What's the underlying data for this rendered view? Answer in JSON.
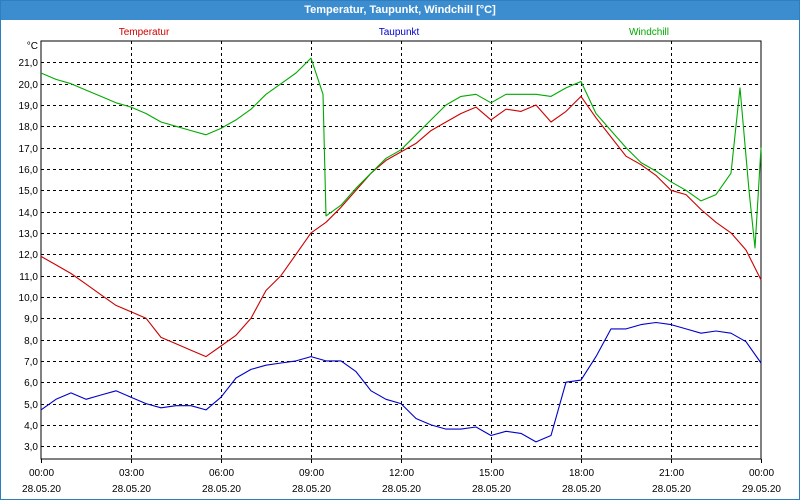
{
  "window": {
    "title": "Temperatur, Taupunkt, Windchill [°C]"
  },
  "chart_data": {
    "type": "line",
    "title": "Temperatur, Taupunkt, Windchill [°C]",
    "ylabel": "°C",
    "ylim": [
      2.4,
      22.0
    ],
    "yticks": [
      "21,0",
      "20,0",
      "19,0",
      "18,0",
      "17,0",
      "16,0",
      "15,0",
      "14,0",
      "13,0",
      "12,0",
      "11,0",
      "10,0",
      "9,0",
      "8,0",
      "7,0",
      "6,0",
      "5,0",
      "4,0",
      "3,0"
    ],
    "xlim": [
      0,
      24
    ],
    "xticks": [
      {
        "time": "00:00",
        "date": "28.05.20"
      },
      {
        "time": "03:00",
        "date": "28.05.20"
      },
      {
        "time": "06:00",
        "date": "28.05.20"
      },
      {
        "time": "09:00",
        "date": "28.05.20"
      },
      {
        "time": "12:00",
        "date": "28.05.20"
      },
      {
        "time": "15:00",
        "date": "28.05.20"
      },
      {
        "time": "18:00",
        "date": "28.05.20"
      },
      {
        "time": "21:00",
        "date": "28.05.20"
      },
      {
        "time": "00:00",
        "date": "29.05.20"
      }
    ],
    "grid": true,
    "legend_position": "top",
    "series": [
      {
        "name": "Temperatur",
        "color": "#cc0000",
        "points": [
          [
            0.0,
            11.9
          ],
          [
            0.5,
            11.5
          ],
          [
            1.0,
            11.1
          ],
          [
            1.5,
            10.6
          ],
          [
            2.0,
            10.1
          ],
          [
            2.5,
            9.6
          ],
          [
            3.0,
            9.3
          ],
          [
            3.5,
            9.0
          ],
          [
            4.0,
            8.1
          ],
          [
            4.5,
            7.8
          ],
          [
            5.0,
            7.5
          ],
          [
            5.5,
            7.2
          ],
          [
            6.0,
            7.7
          ],
          [
            6.5,
            8.2
          ],
          [
            7.0,
            9.0
          ],
          [
            7.5,
            10.3
          ],
          [
            8.0,
            11.0
          ],
          [
            8.5,
            12.0
          ],
          [
            9.0,
            13.0
          ],
          [
            9.5,
            13.5
          ],
          [
            10.0,
            14.2
          ],
          [
            10.5,
            15.0
          ],
          [
            11.0,
            15.8
          ],
          [
            11.5,
            16.4
          ],
          [
            12.0,
            16.8
          ],
          [
            12.5,
            17.2
          ],
          [
            13.0,
            17.8
          ],
          [
            13.5,
            18.2
          ],
          [
            14.0,
            18.6
          ],
          [
            14.5,
            18.9
          ],
          [
            15.0,
            18.3
          ],
          [
            15.5,
            18.8
          ],
          [
            16.0,
            18.7
          ],
          [
            16.5,
            19.0
          ],
          [
            17.0,
            18.2
          ],
          [
            17.5,
            18.7
          ],
          [
            18.0,
            19.4
          ],
          [
            18.5,
            18.4
          ],
          [
            19.0,
            17.5
          ],
          [
            19.5,
            16.6
          ],
          [
            20.0,
            16.2
          ],
          [
            20.5,
            15.7
          ],
          [
            21.0,
            15.0
          ],
          [
            21.5,
            14.8
          ],
          [
            22.0,
            14.1
          ],
          [
            22.5,
            13.5
          ],
          [
            23.0,
            13.0
          ],
          [
            23.5,
            12.2
          ],
          [
            24.0,
            10.8
          ]
        ]
      },
      {
        "name": "Taupunkt",
        "color": "#0000cc",
        "points": [
          [
            0.0,
            4.7
          ],
          [
            0.5,
            5.2
          ],
          [
            1.0,
            5.5
          ],
          [
            1.5,
            5.2
          ],
          [
            2.0,
            5.4
          ],
          [
            2.5,
            5.6
          ],
          [
            3.0,
            5.3
          ],
          [
            3.5,
            5.0
          ],
          [
            4.0,
            4.8
          ],
          [
            4.5,
            4.9
          ],
          [
            5.0,
            4.9
          ],
          [
            5.5,
            4.7
          ],
          [
            6.0,
            5.3
          ],
          [
            6.5,
            6.2
          ],
          [
            7.0,
            6.6
          ],
          [
            7.5,
            6.8
          ],
          [
            8.0,
            6.9
          ],
          [
            8.5,
            7.0
          ],
          [
            9.0,
            7.2
          ],
          [
            9.5,
            7.0
          ],
          [
            10.0,
            7.0
          ],
          [
            10.5,
            6.5
          ],
          [
            11.0,
            5.6
          ],
          [
            11.5,
            5.2
          ],
          [
            12.0,
            5.0
          ],
          [
            12.5,
            4.3
          ],
          [
            13.0,
            4.0
          ],
          [
            13.5,
            3.8
          ],
          [
            14.0,
            3.8
          ],
          [
            14.5,
            3.9
          ],
          [
            15.0,
            3.5
          ],
          [
            15.5,
            3.7
          ],
          [
            16.0,
            3.6
          ],
          [
            16.5,
            3.2
          ],
          [
            17.0,
            3.5
          ],
          [
            17.5,
            6.0
          ],
          [
            18.0,
            6.1
          ],
          [
            18.5,
            7.2
          ],
          [
            19.0,
            8.5
          ],
          [
            19.5,
            8.5
          ],
          [
            20.0,
            8.7
          ],
          [
            20.5,
            8.8
          ],
          [
            21.0,
            8.7
          ],
          [
            21.5,
            8.5
          ],
          [
            22.0,
            8.3
          ],
          [
            22.5,
            8.4
          ],
          [
            23.0,
            8.3
          ],
          [
            23.5,
            7.9
          ],
          [
            24.0,
            6.9
          ]
        ]
      },
      {
        "name": "Windchill",
        "color": "#00aa00",
        "points": [
          [
            0.0,
            20.5
          ],
          [
            0.5,
            20.2
          ],
          [
            1.0,
            20.0
          ],
          [
            1.5,
            19.7
          ],
          [
            2.0,
            19.4
          ],
          [
            2.5,
            19.1
          ],
          [
            3.0,
            18.9
          ],
          [
            3.5,
            18.6
          ],
          [
            4.0,
            18.2
          ],
          [
            4.5,
            18.0
          ],
          [
            5.0,
            17.8
          ],
          [
            5.5,
            17.6
          ],
          [
            6.0,
            17.9
          ],
          [
            6.5,
            18.3
          ],
          [
            7.0,
            18.8
          ],
          [
            7.5,
            19.5
          ],
          [
            8.0,
            20.0
          ],
          [
            8.5,
            20.5
          ],
          [
            9.0,
            21.2
          ],
          [
            9.4,
            19.5
          ],
          [
            9.5,
            13.8
          ],
          [
            10.0,
            14.3
          ],
          [
            10.5,
            15.1
          ],
          [
            11.0,
            15.8
          ],
          [
            11.5,
            16.5
          ],
          [
            12.0,
            16.9
          ],
          [
            12.5,
            17.6
          ],
          [
            13.0,
            18.3
          ],
          [
            13.5,
            19.0
          ],
          [
            14.0,
            19.4
          ],
          [
            14.5,
            19.5
          ],
          [
            15.0,
            19.1
          ],
          [
            15.5,
            19.5
          ],
          [
            16.0,
            19.5
          ],
          [
            16.5,
            19.5
          ],
          [
            17.0,
            19.4
          ],
          [
            17.5,
            19.8
          ],
          [
            18.0,
            20.1
          ],
          [
            18.5,
            18.6
          ],
          [
            19.0,
            17.8
          ],
          [
            19.5,
            17.0
          ],
          [
            20.0,
            16.3
          ],
          [
            20.5,
            15.9
          ],
          [
            21.0,
            15.4
          ],
          [
            21.5,
            15.0
          ],
          [
            22.0,
            14.5
          ],
          [
            22.5,
            14.8
          ],
          [
            23.0,
            15.8
          ],
          [
            23.3,
            19.8
          ],
          [
            23.6,
            15.0
          ],
          [
            23.8,
            12.3
          ],
          [
            24.0,
            17.0
          ]
        ]
      }
    ]
  }
}
